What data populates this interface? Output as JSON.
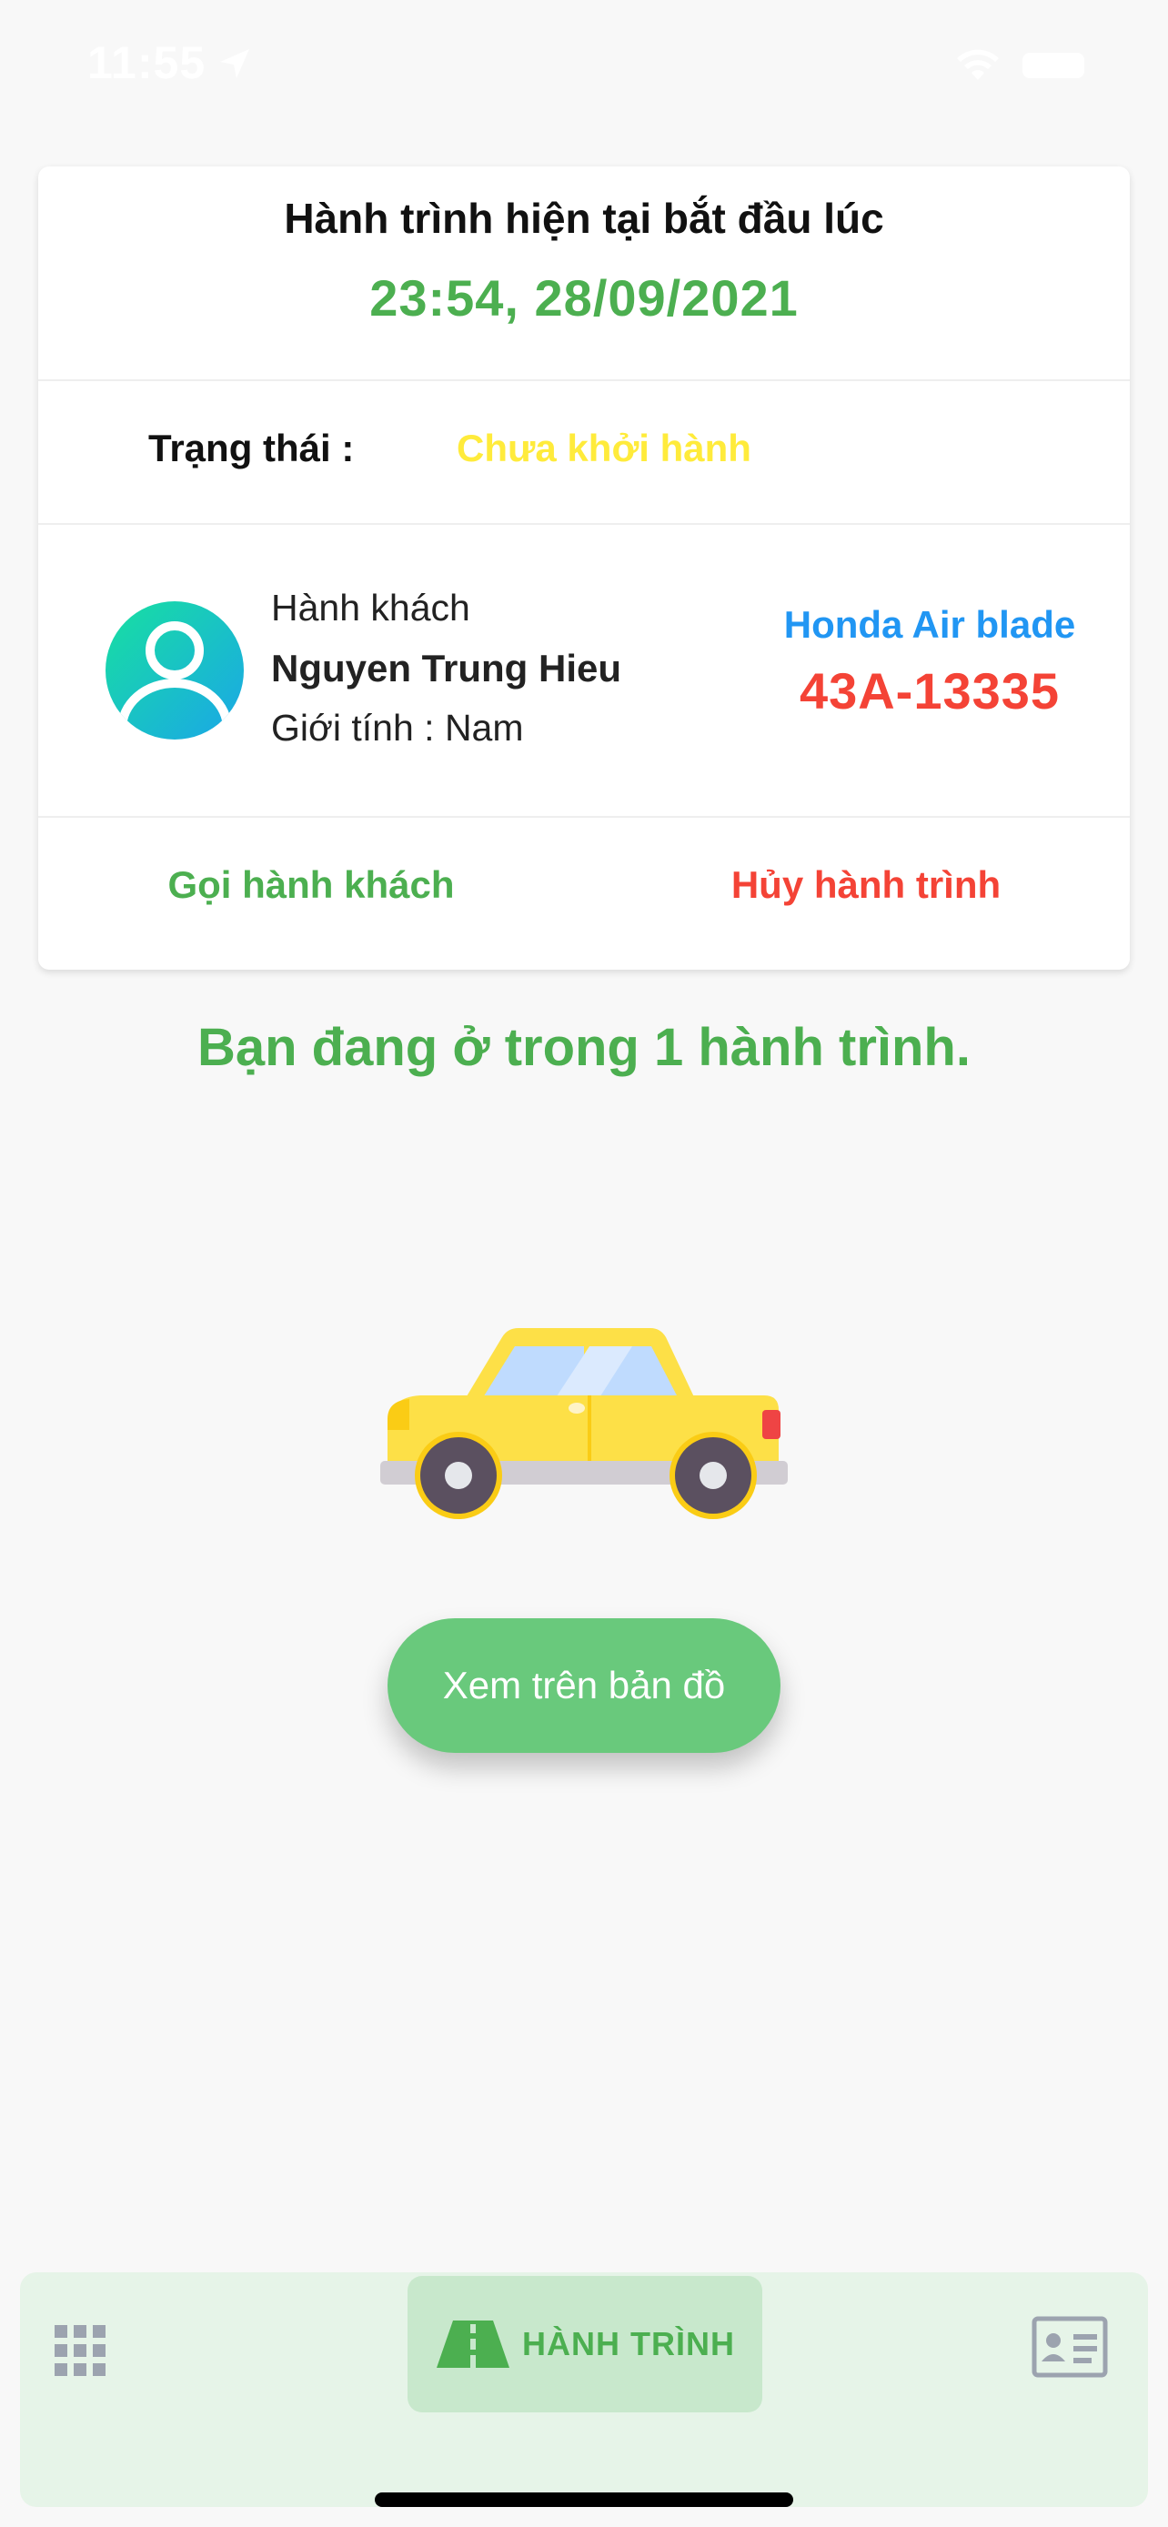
{
  "status_bar": {
    "time": "11:55",
    "icons": [
      "location-arrow-icon",
      "wifi-icon",
      "battery-icon"
    ]
  },
  "trip": {
    "start_label": "Hành trình hiện tại bắt đầu lúc",
    "start_time": "23:54, 28/09/2021",
    "status_label": "Trạng thái :",
    "status_value": "Chưa khởi hành",
    "passenger": {
      "role": "Hành khách",
      "name": "Nguyen Trung Hieu",
      "gender": "Giới tính : Nam"
    },
    "vehicle": {
      "model": "Honda Air blade",
      "plate": "43A-13335"
    },
    "actions": {
      "call": "Gọi hành khách",
      "cancel": "Hủy hành trình"
    }
  },
  "message": "Bạn đang ở trong 1 hành trình.",
  "map_button": "Xem trên bản đồ",
  "nav": {
    "active_label": "HÀNH TRÌNH",
    "icons": [
      "grid-icon",
      "road-icon",
      "id-card-icon"
    ]
  },
  "colors": {
    "green": "#4caf50",
    "yellow": "#ffeb3b",
    "blue": "#2196f3",
    "red": "#f44336",
    "button_green": "#69c97c",
    "nav_bg": "#e6f4e8"
  }
}
